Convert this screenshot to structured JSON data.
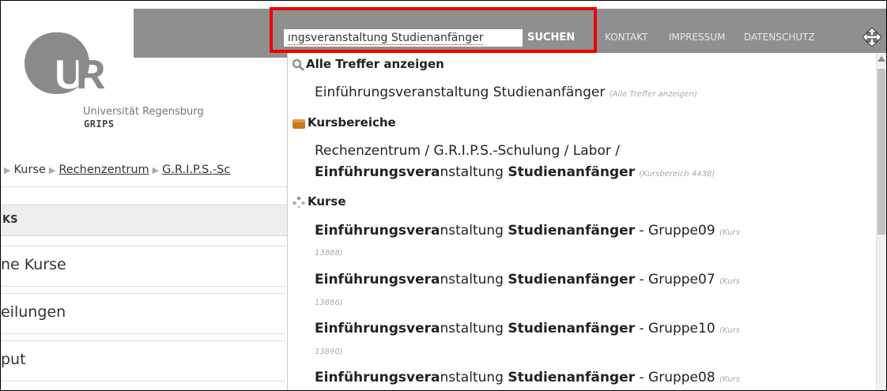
{
  "logo": {
    "letter_u": "U",
    "letter_r": "R",
    "university": "Universität Regensburg",
    "product": "GRIPS"
  },
  "breadcrumb": {
    "items": [
      "Kurse",
      "Rechenzentrum",
      "G.R.I.P.S.-Sc"
    ]
  },
  "nav": {
    "header": "KS",
    "items": [
      "ne Kurse",
      "eilungen",
      "put"
    ]
  },
  "search": {
    "value": "ıngsveranstaltung Studienanfänger",
    "button_label": "SUCHEN"
  },
  "topnav": {
    "links": [
      "KONTAKT",
      "IMPRESSUM",
      "DATENSCHUTZ"
    ]
  },
  "dropdown": {
    "all_results": {
      "title": "Alle Treffer anzeigen",
      "item": "Einführungsveranstaltung Studienanfänger",
      "item_note": "(Alle Treffer anzeigen)"
    },
    "categories": {
      "title": "Kursbereiche",
      "path": "Rechenzentrum / G.R.I.P.S.-Schulung / Labor /",
      "item_bold1": "Einführungsvera",
      "item_normal": "nstaltung ",
      "item_bold2": "Studienanfänger",
      "item_note": "(Kursbereich 4438)"
    },
    "courses": {
      "title": "Kurse",
      "items": [
        {
          "bold1": "Einführungsvera",
          "normal": "nstaltung ",
          "bold2": "Studienanfänger",
          "suffix": " - Gruppe09 ",
          "note1": "(Kurs",
          "note2": "13888)"
        },
        {
          "bold1": "Einführungsvera",
          "normal": "nstaltung ",
          "bold2": "Studienanfänger",
          "suffix": " - Gruppe07 ",
          "note1": "(Kurs",
          "note2": "13886)"
        },
        {
          "bold1": "Einführungsvera",
          "normal": "nstaltung ",
          "bold2": "Studienanfänger",
          "suffix": " - Gruppe10 ",
          "note1": "(Kurs",
          "note2": "13890)"
        },
        {
          "bold1": "Einführungsvera",
          "normal": "nstaltung ",
          "bold2": "Studienanfänger",
          "suffix": " - Gruppe08 ",
          "note1": "(Kurs",
          "note2": ""
        }
      ]
    }
  },
  "icons": {
    "search": "search-icon",
    "category": "folder-icon",
    "course": "course-icon",
    "resize": "resize-arrows-icon"
  },
  "colors": {
    "topbar": "#8f8f8f",
    "highlight": "#ee0000",
    "logo": "#8a8a8a"
  }
}
